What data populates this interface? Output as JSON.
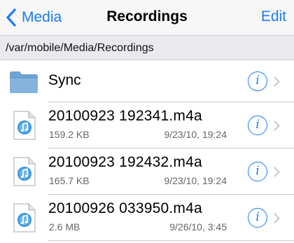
{
  "navbar": {
    "back_label": "Media",
    "title": "Recordings",
    "edit_label": "Edit"
  },
  "path": "/var/mobile/Media/Recordings",
  "items": [
    {
      "name": "Sync",
      "kind": "folder",
      "icon": "folder-icon"
    },
    {
      "name": "20100923 192341.m4a",
      "size": "159.2 KB",
      "date": "9/23/10, 19:24",
      "kind": "file",
      "icon": "audio-file-icon"
    },
    {
      "name": "20100923 192432.m4a",
      "size": "165.7 KB",
      "date": "9/23/10, 19:24",
      "kind": "file",
      "icon": "audio-file-icon"
    },
    {
      "name": "20100926 033950.m4a",
      "size": "2.6 MB",
      "date": "9/26/10, 3:45",
      "kind": "file",
      "icon": "audio-file-icon"
    }
  ],
  "colors": {
    "accent": "#1a7cf5",
    "navbar_bg": "#f7f7f7",
    "pathbar_bg": "#e9e9ee",
    "folder": "#6fa3d3"
  }
}
